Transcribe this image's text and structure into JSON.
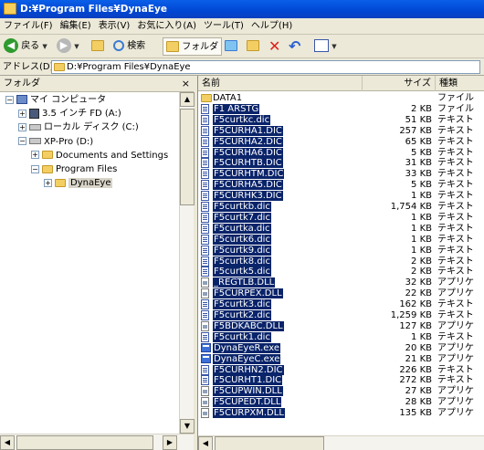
{
  "window": {
    "title": "D:¥Program Files¥DynaEye"
  },
  "menu": [
    "ファイル(F)",
    "編集(E)",
    "表示(V)",
    "お気に入り(A)",
    "ツール(T)",
    "ヘルプ(H)"
  ],
  "toolbar": {
    "back": "戻る",
    "search": "検索",
    "folders": "フォルダ"
  },
  "address": {
    "label": "アドレス(D)",
    "value": "D:¥Program Files¥DynaEye"
  },
  "folder_pane": {
    "title": "フォルダ",
    "close": "×",
    "tree": [
      {
        "label": "マイ コンピュータ",
        "expander": "−",
        "icon": "computer-icon"
      },
      {
        "label": "3.5 インチ FD (A:)",
        "expander": "+",
        "icon": "floppy-icon"
      },
      {
        "label": "ローカル ディスク (C:)",
        "expander": "+",
        "icon": "drive-icon"
      },
      {
        "label": "XP-Pro (D:)",
        "expander": "−",
        "icon": "drive-icon"
      },
      {
        "label": "Documents and Settings",
        "expander": "+",
        "icon": "folder-icon"
      },
      {
        "label": "Program Files",
        "expander": "−",
        "icon": "folder-icon"
      },
      {
        "label": "DynaEye",
        "expander": "+",
        "icon": "folder-icon",
        "selected": true
      }
    ]
  },
  "file_pane": {
    "columns": {
      "name": "名前",
      "size": "サイズ",
      "type": "種類"
    },
    "files": [
      {
        "name": "DATA1",
        "size": "",
        "type": "ファイル",
        "icon": "folder-icon",
        "selected": false
      },
      {
        "name": "F1 ARSTG",
        "size": "2 KB",
        "type": "ファイル",
        "icon": "doc-icon",
        "selected": true
      },
      {
        "name": "F5curtkc.dic",
        "size": "51 KB",
        "type": "テキスト",
        "icon": "doc-icon",
        "selected": true
      },
      {
        "name": "F5CURHA1.DIC",
        "size": "257 KB",
        "type": "テキスト",
        "icon": "doc-icon",
        "selected": true
      },
      {
        "name": "F5CURHA2.DIC",
        "size": "65 KB",
        "type": "テキスト",
        "icon": "doc-icon",
        "selected": true
      },
      {
        "name": "F5CURHA6.DIC",
        "size": "5 KB",
        "type": "テキスト",
        "icon": "doc-icon",
        "selected": true
      },
      {
        "name": "F5CURHTB.DIC",
        "size": "31 KB",
        "type": "テキスト",
        "icon": "doc-icon",
        "selected": true
      },
      {
        "name": "F5CURHTM.DIC",
        "size": "33 KB",
        "type": "テキスト",
        "icon": "doc-icon",
        "selected": true
      },
      {
        "name": "F5CURHA5.DIC",
        "size": "5 KB",
        "type": "テキスト",
        "icon": "doc-icon",
        "selected": true
      },
      {
        "name": "F5CURHK3.DIC",
        "size": "1 KB",
        "type": "テキスト",
        "icon": "doc-icon",
        "selected": true
      },
      {
        "name": "F5curtkb.dic",
        "size": "1,754 KB",
        "type": "テキスト",
        "icon": "doc-icon",
        "selected": true
      },
      {
        "name": "F5curtk7.dic",
        "size": "1 KB",
        "type": "テキスト",
        "icon": "doc-icon",
        "selected": true
      },
      {
        "name": "F5curtka.dic",
        "size": "1 KB",
        "type": "テキスト",
        "icon": "doc-icon",
        "selected": true
      },
      {
        "name": "F5curtk6.dic",
        "size": "1 KB",
        "type": "テキスト",
        "icon": "doc-icon",
        "selected": true
      },
      {
        "name": "F5curtk9.dic",
        "size": "1 KB",
        "type": "テキスト",
        "icon": "doc-icon",
        "selected": true
      },
      {
        "name": "F5curtk8.dic",
        "size": "2 KB",
        "type": "テキスト",
        "icon": "doc-icon",
        "selected": true
      },
      {
        "name": "F5curtk5.dic",
        "size": "2 KB",
        "type": "テキスト",
        "icon": "doc-icon",
        "selected": true
      },
      {
        "name": "_REGTLB.DLL",
        "size": "32 KB",
        "type": "アプリケ",
        "icon": "dll-icon",
        "selected": true
      },
      {
        "name": "F5CURPEX.DLL",
        "size": "22 KB",
        "type": "アプリケ",
        "icon": "dll-icon",
        "selected": true
      },
      {
        "name": "F5curtk3.dic",
        "size": "162 KB",
        "type": "テキスト",
        "icon": "doc-icon",
        "selected": true
      },
      {
        "name": "F5curtk2.dic",
        "size": "1,259 KB",
        "type": "テキスト",
        "icon": "doc-icon",
        "selected": true
      },
      {
        "name": "F5BDKABC.DLL",
        "size": "127 KB",
        "type": "アプリケ",
        "icon": "dll-icon",
        "selected": true
      },
      {
        "name": "F5curtk1.dic",
        "size": "1 KB",
        "type": "テキスト",
        "icon": "doc-icon",
        "selected": true
      },
      {
        "name": "DynaEyeR.exe",
        "size": "20 KB",
        "type": "アプリケ",
        "icon": "exe-icon",
        "selected": true
      },
      {
        "name": "DynaEyeC.exe",
        "size": "21 KB",
        "type": "アプリケ",
        "icon": "exe-icon",
        "selected": true
      },
      {
        "name": "F5CURHN2.DIC",
        "size": "226 KB",
        "type": "テキスト",
        "icon": "doc-icon",
        "selected": true
      },
      {
        "name": "F5CURHT1.DIC",
        "size": "272 KB",
        "type": "テキスト",
        "icon": "doc-icon",
        "selected": true
      },
      {
        "name": "F5CUPWIN.DLL",
        "size": "27 KB",
        "type": "アプリケ",
        "icon": "dll-icon",
        "selected": true
      },
      {
        "name": "F5CUPEDT.DLL",
        "size": "28 KB",
        "type": "アプリケ",
        "icon": "dll-icon",
        "selected": true
      },
      {
        "name": "F5CURPXM.DLL",
        "size": "135 KB",
        "type": "アプリケ",
        "icon": "dll-icon",
        "selected": true
      }
    ]
  },
  "colors": {
    "titlebar": "#0047d4",
    "selection": "#0a246a",
    "chrome": "#ece9d8"
  }
}
